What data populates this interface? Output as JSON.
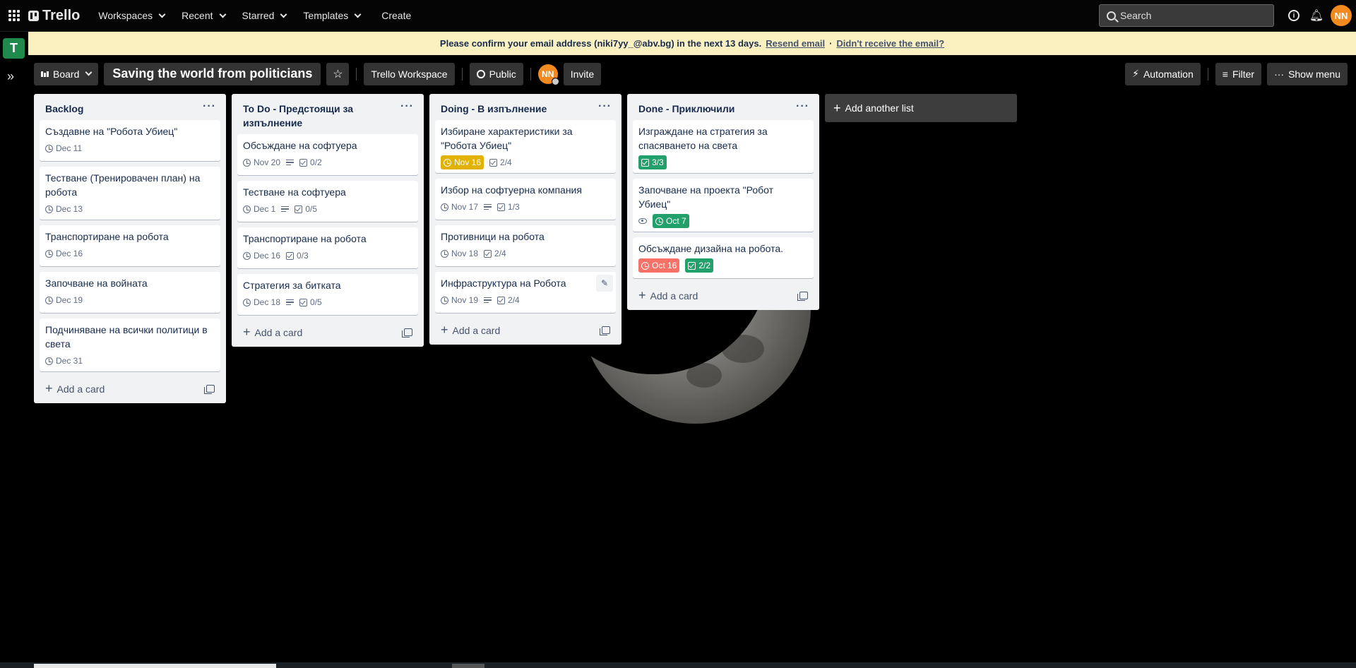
{
  "header": {
    "logo": "Trello",
    "nav": [
      "Workspaces",
      "Recent",
      "Starred",
      "Templates"
    ],
    "create": "Create",
    "search_placeholder": "Search",
    "user_initials": "NN"
  },
  "workspace_badge": "T",
  "banner": {
    "message": "Please confirm your email address (niki7yy_@abv.bg) in the next 13 days.",
    "resend": "Resend email",
    "separator": "·",
    "didnt_receive": "Didn't receive the email?"
  },
  "board": {
    "view": "Board",
    "title": "Saving the world from politicians",
    "workspace": "Trello Workspace",
    "visibility": "Public",
    "member_initials": "NN",
    "invite": "Invite",
    "automation": "Automation",
    "filter": "Filter",
    "show_menu": "Show menu"
  },
  "lists": [
    {
      "title": "Backlog",
      "cards": [
        {
          "title": "Създавне на \"Робота Убиец\"",
          "due": "Dec 11"
        },
        {
          "title": "Тестване (Тренировачен план) на робота",
          "due": "Dec 13"
        },
        {
          "title": "Транспортиране на робота",
          "due": "Dec 16"
        },
        {
          "title": "Започване на войната",
          "due": "Dec 19"
        },
        {
          "title": "Подчиняване на всички политици в света",
          "due": "Dec 31"
        }
      ]
    },
    {
      "title": "To Do - Предстоящи за изпълнение",
      "cards": [
        {
          "title": "Обсъждане на софтуера",
          "due": "Nov 20",
          "checklist": "0/2"
        },
        {
          "title": "Тестване на софтуера",
          "due": "Dec 1",
          "checklist": "0/5"
        },
        {
          "title": "Транспортиране на робота",
          "due": "Dec 16",
          "checklist": "0/3"
        },
        {
          "title": "Стратегия за битката",
          "due": "Dec 18",
          "checklist": "0/5"
        }
      ]
    },
    {
      "title": "Doing - В изпълнение",
      "cards": [
        {
          "title": "Избиране характеристики за \"Робота Убиец\"",
          "due": "Nov 16",
          "checklist": "2/4"
        },
        {
          "title": "Избор на софтуерна компания",
          "due": "Nov 17",
          "checklist": "1/3"
        },
        {
          "title": "Противници на робота",
          "due": "Nov 18",
          "checklist": "2/4"
        },
        {
          "title": "Инфраструктура на Робота",
          "due": "Nov 19",
          "checklist": "2/4"
        }
      ]
    },
    {
      "title": "Done - Приключили",
      "cards": [
        {
          "title": "Изграждане на стратегия за спасяването на света",
          "checklist": "3/3"
        },
        {
          "title": "Започване на проекта \"Робот Убиец\"",
          "due": "Oct 7"
        },
        {
          "title": "Обсъждане дизайна на робота.",
          "due": "Oct 16",
          "checklist": "2/2"
        }
      ]
    }
  ],
  "add_card": "Add a card",
  "add_list": "Add another list",
  "colors": {
    "banner_bg": "#fbf0c0",
    "list_bg": "#f1f2f4",
    "due_yellow": "#e2b203",
    "due_green": "#22a06b",
    "due_red": "#f87168",
    "avatar": "#f28a1f",
    "workspace_badge": "#1f8a4c"
  }
}
